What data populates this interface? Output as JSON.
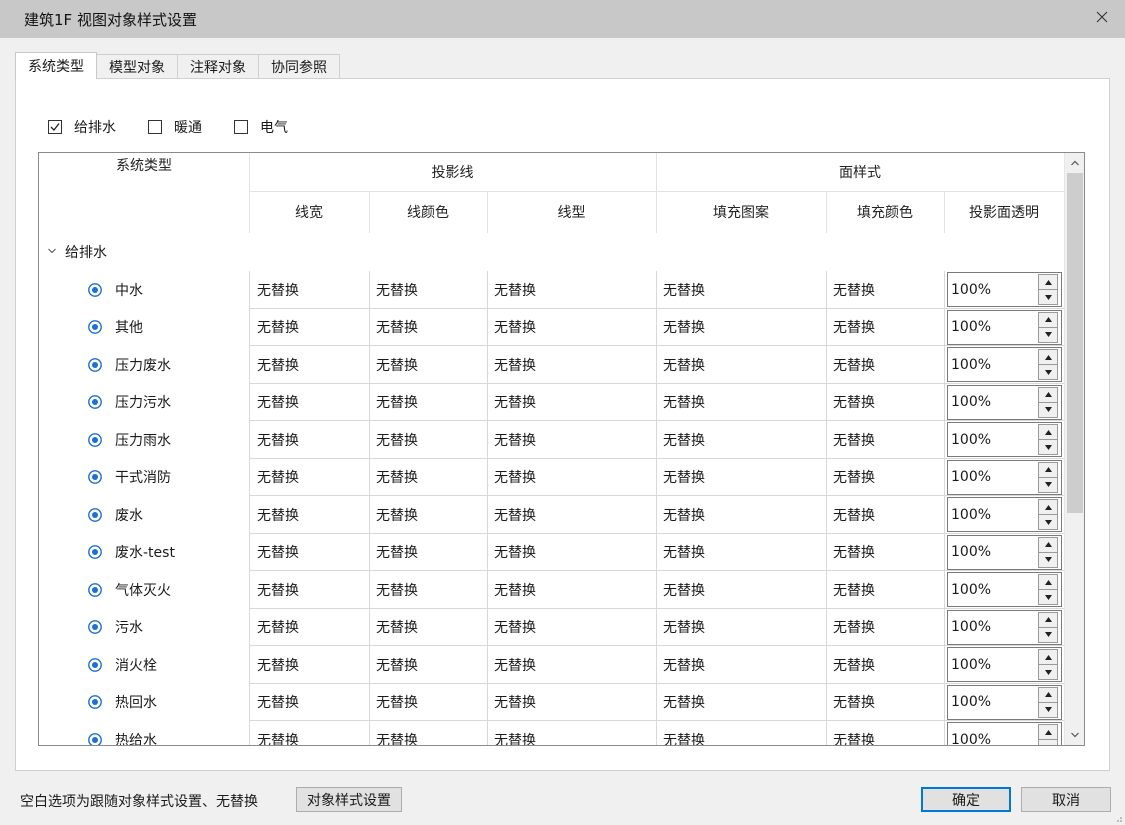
{
  "window": {
    "title": "建筑1F 视图对象样式设置",
    "close_glyph": "✕"
  },
  "tabs": [
    {
      "label": "系统类型",
      "active": true
    },
    {
      "label": "模型对象",
      "active": false
    },
    {
      "label": "注释对象",
      "active": false
    },
    {
      "label": "协同参照",
      "active": false
    }
  ],
  "filters": [
    {
      "label": "给排水",
      "checked": true
    },
    {
      "label": "暖通",
      "checked": false
    },
    {
      "label": "电气",
      "checked": false
    }
  ],
  "headers": {
    "system_type": "系统类型",
    "projection_line": "投影线",
    "surface_style": "面样式",
    "line_width": "线宽",
    "line_color": "线颜色",
    "line_type": "线型",
    "fill_pattern": "填充图案",
    "fill_color": "填充颜色",
    "projection_transparency": "投影面透明"
  },
  "group": {
    "label": "给排水",
    "chevron": "⌄"
  },
  "rows": [
    {
      "name": "中水",
      "line_width": "无替换",
      "line_color": "无替换",
      "line_type": "无替换",
      "fill_pattern": "无替换",
      "fill_color": "无替换",
      "transparency": "100%"
    },
    {
      "name": "其他",
      "line_width": "无替换",
      "line_color": "无替换",
      "line_type": "无替换",
      "fill_pattern": "无替换",
      "fill_color": "无替换",
      "transparency": "100%"
    },
    {
      "name": "压力废水",
      "line_width": "无替换",
      "line_color": "无替换",
      "line_type": "无替换",
      "fill_pattern": "无替换",
      "fill_color": "无替换",
      "transparency": "100%"
    },
    {
      "name": "压力污水",
      "line_width": "无替换",
      "line_color": "无替换",
      "line_type": "无替换",
      "fill_pattern": "无替换",
      "fill_color": "无替换",
      "transparency": "100%"
    },
    {
      "name": "压力雨水",
      "line_width": "无替换",
      "line_color": "无替换",
      "line_type": "无替换",
      "fill_pattern": "无替换",
      "fill_color": "无替换",
      "transparency": "100%"
    },
    {
      "name": "干式消防",
      "line_width": "无替换",
      "line_color": "无替换",
      "line_type": "无替换",
      "fill_pattern": "无替换",
      "fill_color": "无替换",
      "transparency": "100%"
    },
    {
      "name": "废水",
      "line_width": "无替换",
      "line_color": "无替换",
      "line_type": "无替换",
      "fill_pattern": "无替换",
      "fill_color": "无替换",
      "transparency": "100%"
    },
    {
      "name": "废水-test",
      "line_width": "无替换",
      "line_color": "无替换",
      "line_type": "无替换",
      "fill_pattern": "无替换",
      "fill_color": "无替换",
      "transparency": "100%"
    },
    {
      "name": "气体灭火",
      "line_width": "无替换",
      "line_color": "无替换",
      "line_type": "无替换",
      "fill_pattern": "无替换",
      "fill_color": "无替换",
      "transparency": "100%"
    },
    {
      "name": "污水",
      "line_width": "无替换",
      "line_color": "无替换",
      "line_type": "无替换",
      "fill_pattern": "无替换",
      "fill_color": "无替换",
      "transparency": "100%"
    },
    {
      "name": "消火栓",
      "line_width": "无替换",
      "line_color": "无替换",
      "line_type": "无替换",
      "fill_pattern": "无替换",
      "fill_color": "无替换",
      "transparency": "100%"
    },
    {
      "name": "热回水",
      "line_width": "无替换",
      "line_color": "无替换",
      "line_type": "无替换",
      "fill_pattern": "无替换",
      "fill_color": "无替换",
      "transparency": "100%"
    },
    {
      "name": "热给水",
      "line_width": "无替换",
      "line_color": "无替换",
      "line_type": "无替换",
      "fill_pattern": "无替换",
      "fill_color": "无替换",
      "transparency": "100%"
    }
  ],
  "footer": {
    "note": "空白选项为跟随对象样式设置、无替换",
    "object_style_button": "对象样式设置",
    "ok_button": "确定",
    "cancel_button": "取消"
  },
  "colors": {
    "eye_icon": "#1e6fd0",
    "primary_border": "#0078d7",
    "titlebar": "#c8c8c8"
  },
  "icons": {
    "visibility": "eye-icon",
    "close": "close-icon",
    "group_toggle": "chevron-down-icon"
  }
}
